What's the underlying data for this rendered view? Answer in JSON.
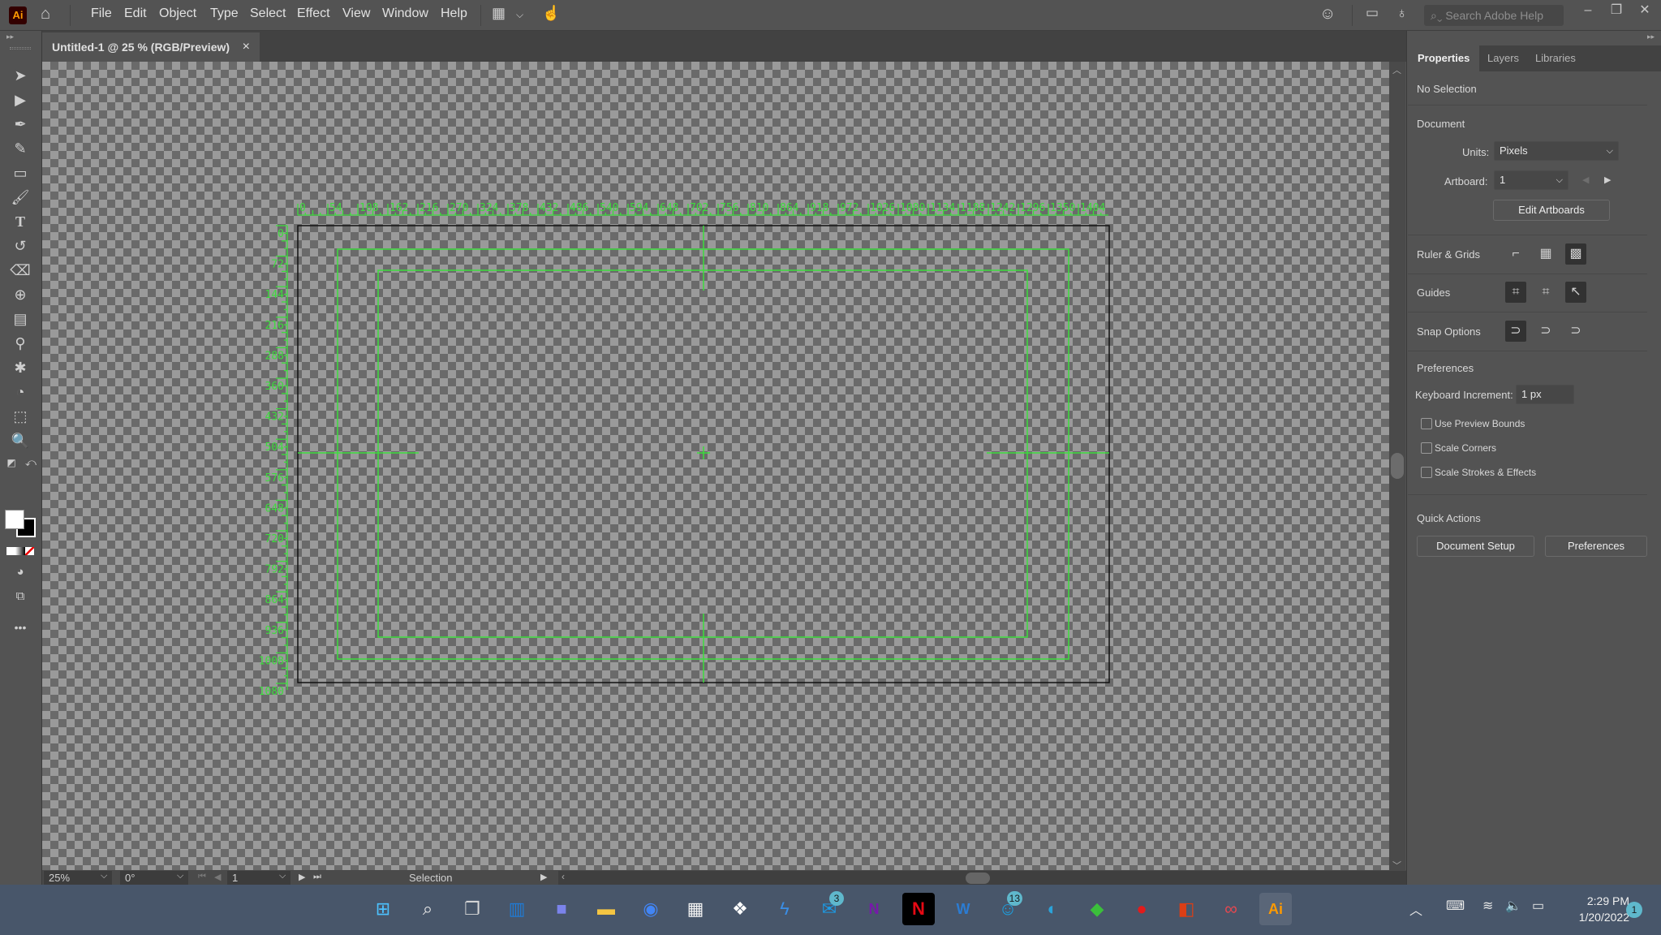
{
  "app": {
    "logo": "Ai",
    "name": "Adobe Illustrator"
  },
  "menu": [
    "File",
    "Edit",
    "Object",
    "Type",
    "Select",
    "Effect",
    "View",
    "Window",
    "Help"
  ],
  "topbar": {
    "search_placeholder": "Search Adobe Help",
    "icons": [
      "workspace-layout-icon",
      "chevron-down-icon",
      "touch-workspace-icon",
      "add-user-icon",
      "panel-toggle-icon",
      "lightbulb-icon"
    ],
    "window_controls": [
      "minimize",
      "restore",
      "close"
    ]
  },
  "document_tab": {
    "title": "Untitled-1 @ 25 % (RGB/Preview)",
    "close": "×"
  },
  "tools": [
    "selection",
    "direct-selection",
    "pen",
    "curvature",
    "rectangle",
    "paintbrush",
    "type",
    "rotate",
    "eraser",
    "shape-builder",
    "gradient",
    "eyedropper",
    "puppet-warp",
    "blend",
    "artboard",
    "zoom",
    "default-fill-stroke",
    "swap-fill-stroke",
    "fill",
    "stroke",
    "color-gradient-none",
    "draw-mode",
    "screen-mode",
    "more"
  ],
  "canvas": {
    "top_ruler_labels": [
      "0",
      "54",
      "108",
      "162",
      "216",
      "270",
      "324",
      "378",
      "432",
      "486",
      "540",
      "594",
      "648",
      "702",
      "756",
      "810",
      "864",
      "918",
      "972",
      "1026",
      "1080",
      "1134",
      "1188",
      "1242",
      "1296",
      "1350",
      "1404"
    ],
    "left_ruler_labels": [
      "0",
      "72",
      "144",
      "216",
      "288",
      "360",
      "432",
      "504",
      "576",
      "648",
      "720",
      "792",
      "864",
      "936",
      "1008",
      "1080"
    ],
    "guide_color": "#3ddc3d"
  },
  "statusbar": {
    "zoom": "25%",
    "rotation": "0°",
    "artboard": "1",
    "tool": "Selection"
  },
  "panel": {
    "tabs": [
      "Properties",
      "Layers",
      "Libraries"
    ],
    "active_tab": "Properties",
    "selection": "No Selection",
    "document_heading": "Document",
    "units_label": "Units:",
    "units_value": "Pixels",
    "artboard_label": "Artboard:",
    "artboard_value": "1",
    "edit_artboards": "Edit Artboards",
    "ruler_grids": "Ruler & Grids",
    "guides": "Guides",
    "snap_options": "Snap Options",
    "preferences_heading": "Preferences",
    "keyboard_increment_label": "Keyboard Increment:",
    "keyboard_increment_value": "1 px",
    "checkboxes": [
      {
        "label": "Use Preview Bounds",
        "checked": false
      },
      {
        "label": "Scale Corners",
        "checked": false
      },
      {
        "label": "Scale Strokes & Effects",
        "checked": false
      }
    ],
    "quick_actions": "Quick Actions",
    "document_setup": "Document Setup",
    "preferences_button": "Preferences"
  },
  "taskbar": {
    "apps": [
      {
        "name": "start",
        "glyph": "⊞"
      },
      {
        "name": "search",
        "glyph": "⌕"
      },
      {
        "name": "task-view",
        "glyph": "❐"
      },
      {
        "name": "widgets",
        "glyph": "▥"
      },
      {
        "name": "teams-chat",
        "glyph": "■"
      },
      {
        "name": "file-explorer",
        "glyph": "▬"
      },
      {
        "name": "chrome",
        "glyph": "◉"
      },
      {
        "name": "microsoft-store",
        "glyph": "▦"
      },
      {
        "name": "dropbox",
        "glyph": "❖"
      },
      {
        "name": "app-lightning",
        "glyph": "ϟ"
      },
      {
        "name": "mail",
        "glyph": "✉",
        "badge": "3"
      },
      {
        "name": "onenote",
        "glyph": "N"
      },
      {
        "name": "netflix",
        "glyph": "N"
      },
      {
        "name": "word",
        "glyph": "W"
      },
      {
        "name": "messaging",
        "glyph": "☺",
        "badge": "13"
      },
      {
        "name": "edge",
        "glyph": "◐"
      },
      {
        "name": "sims",
        "glyph": "◆"
      },
      {
        "name": "recorder",
        "glyph": "●"
      },
      {
        "name": "office",
        "glyph": "◧"
      },
      {
        "name": "creative-cloud",
        "glyph": "∞"
      },
      {
        "name": "illustrator",
        "glyph": "Ai"
      }
    ],
    "time": "2:29 PM",
    "date": "1/20/2022",
    "notifications": "1"
  }
}
